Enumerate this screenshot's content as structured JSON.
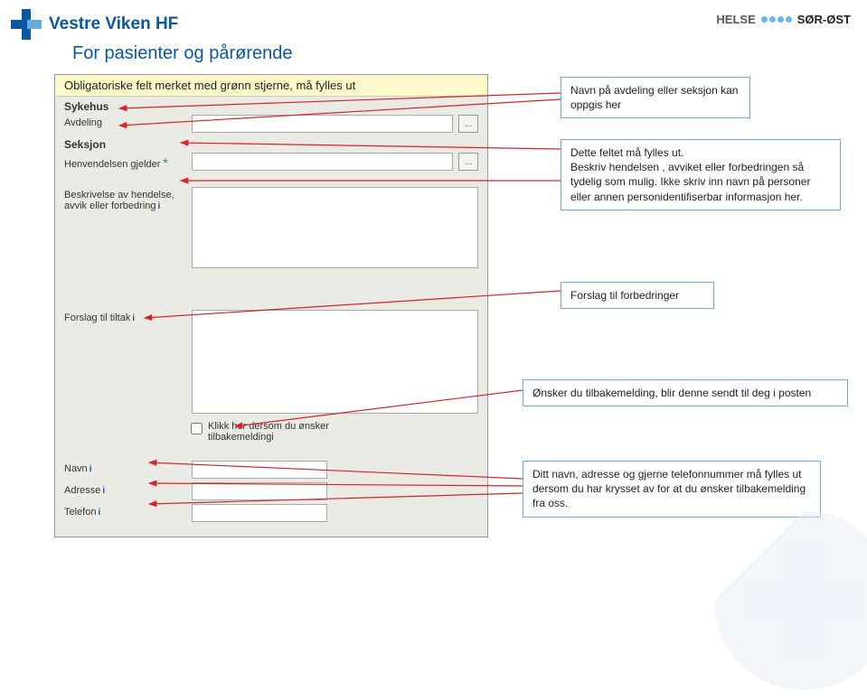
{
  "header": {
    "brand": "Vestre Viken HF",
    "right_label_a": "HELSE",
    "right_label_b": "SØR-ØST"
  },
  "page_title": "For pasienter og pårørende",
  "form": {
    "banner": "Obligatoriske felt merket med grønn stjerne, må fylles ut",
    "section_sykehus": "Sykehus",
    "label_avdeling": "Avdeling",
    "section_seksjon": "Seksjon",
    "label_henvendelse": "Henvendelsen gjelder",
    "label_beskrivelse": "Beskrivelse av hendelse, avvik eller forbedring",
    "label_forslag": "Forslag til tiltak",
    "checkbox_label": "Klikk her dersom du ønsker tilbakemelding",
    "label_navn": "Navn",
    "label_adresse": "Adresse",
    "label_telefon": "Telefon",
    "lookup": "..."
  },
  "callouts": {
    "c1": "Navn på avdeling eller seksjon kan oppgis her",
    "c2": "Dette feltet må fylles ut.\nBeskriv hendelsen , avviket eller  forbedringen så tydelig som mulig. Ikke skriv inn navn på personer eller annen personidentifiserbar informasjon her.",
    "c3": "Forslag til forbedringer",
    "c4": "Ønsker du tilbakemelding, blir denne sendt til deg i posten",
    "c5": "Ditt navn, adresse og gjerne telefonnummer må fylles ut dersom du har krysset av for at du ønsker tilbakemelding  fra oss."
  }
}
